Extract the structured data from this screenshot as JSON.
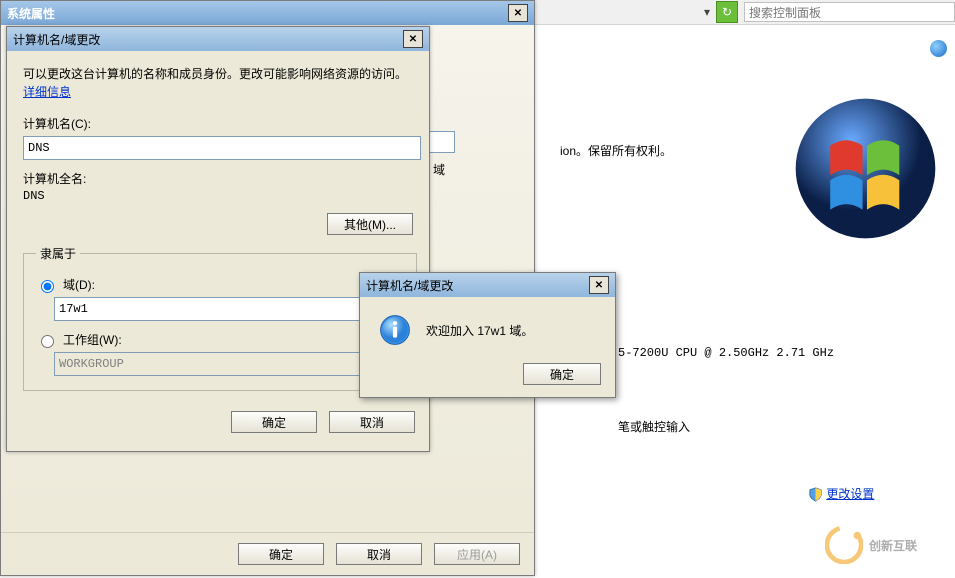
{
  "cp": {
    "search_placeholder": "搜索控制面板",
    "rights": "ion。保留所有权利。",
    "cpu": "5-7200U CPU @ 2.50GHz   2.71 GHz",
    "pen_touch": "笔或触控输入",
    "change_settings": "更改设置",
    "cx": "创新互联"
  },
  "sysprops": {
    "title": "系统属性",
    "ok": "确定",
    "cancel": "取消",
    "apply": "应用(A)"
  },
  "namechg": {
    "title": "计算机名/域更改",
    "desc1": "可以更改这台计算机的名称和成员身份。更改可能影响网络资源的访问。",
    "more_info": "详细信息",
    "label_computername": "计算机名(C):",
    "value_computername": "DNS",
    "label_full": "计算机全名:",
    "value_full": "DNS",
    "other": "其他(M)...",
    "memberof": "隶属于",
    "domain_label": "域(D):",
    "domain_value": "17w1",
    "workgroup_label": "工作组(W):",
    "workgroup_value": "WORKGROUP",
    "ok": "确定",
    "cancel": "取消",
    "partial_label": "域"
  },
  "msg": {
    "title": "计算机名/域更改",
    "text": "欢迎加入 17w1 域。",
    "ok": "确定"
  }
}
